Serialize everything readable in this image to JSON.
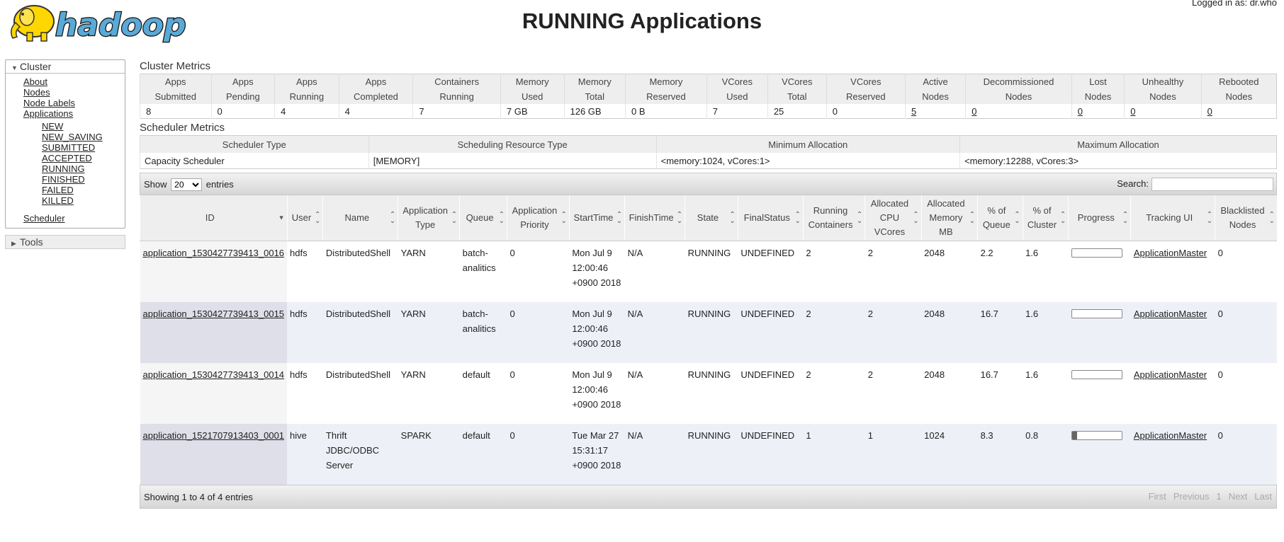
{
  "header": {
    "logo_text": "hadoop",
    "title": "RUNNING Applications",
    "logged_in": "Logged in as: dr.who"
  },
  "sidebar": {
    "cluster_label": "Cluster",
    "links": [
      "About",
      "Nodes",
      "Node Labels",
      "Applications"
    ],
    "app_states": [
      "NEW",
      "NEW_SAVING",
      "SUBMITTED",
      "ACCEPTED",
      "RUNNING",
      "FINISHED",
      "FAILED",
      "KILLED"
    ],
    "scheduler": "Scheduler",
    "tools_label": "Tools"
  },
  "cluster_metrics": {
    "title": "Cluster Metrics",
    "headers": [
      "Apps Submitted",
      "Apps Pending",
      "Apps Running",
      "Apps Completed",
      "Containers Running",
      "Memory Used",
      "Memory Total",
      "Memory Reserved",
      "VCores Used",
      "VCores Total",
      "VCores Reserved",
      "Active Nodes",
      "Decommissioned Nodes",
      "Lost Nodes",
      "Unhealthy Nodes",
      "Rebooted Nodes"
    ],
    "values": [
      "8",
      "0",
      "4",
      "4",
      "7",
      "7 GB",
      "126 GB",
      "0 B",
      "7",
      "25",
      "0",
      "5",
      "0",
      "0",
      "0",
      "0"
    ]
  },
  "scheduler_metrics": {
    "title": "Scheduler Metrics",
    "headers": [
      "Scheduler Type",
      "Scheduling Resource Type",
      "Minimum Allocation",
      "Maximum Allocation"
    ],
    "values": [
      "Capacity Scheduler",
      "[MEMORY]",
      "<memory:1024, vCores:1>",
      "<memory:12288, vCores:3>"
    ]
  },
  "apps_table": {
    "show_label": "Show",
    "entries_label": "entries",
    "page_size": "20",
    "search_label": "Search:",
    "search_value": "",
    "headers": [
      "ID",
      "User",
      "Name",
      "Application Type",
      "Queue",
      "Application Priority",
      "StartTime",
      "FinishTime",
      "State",
      "FinalStatus",
      "Running Containers",
      "Allocated CPU VCores",
      "Allocated Memory MB",
      "% of Queue",
      "% of Cluster",
      "Progress",
      "Tracking UI",
      "Blacklisted Nodes"
    ],
    "rows": [
      {
        "id": "application_1530427739413_0016",
        "user": "hdfs",
        "name": "DistributedShell",
        "type": "YARN",
        "queue": "batch-analitics",
        "priority": "0",
        "start": "Mon Jul 9 12:00:46 +0900 2018",
        "finish": "N/A",
        "state": "RUNNING",
        "final": "UNDEFINED",
        "containers": "2",
        "vcores": "2",
        "memory": "2048",
        "pct_queue": "2.2",
        "pct_cluster": "1.6",
        "progress": 0,
        "tracking": "ApplicationMaster",
        "blacklisted": "0"
      },
      {
        "id": "application_1530427739413_0015",
        "user": "hdfs",
        "name": "DistributedShell",
        "type": "YARN",
        "queue": "batch-analitics",
        "priority": "0",
        "start": "Mon Jul 9 12:00:46 +0900 2018",
        "finish": "N/A",
        "state": "RUNNING",
        "final": "UNDEFINED",
        "containers": "2",
        "vcores": "2",
        "memory": "2048",
        "pct_queue": "16.7",
        "pct_cluster": "1.6",
        "progress": 0,
        "tracking": "ApplicationMaster",
        "blacklisted": "0"
      },
      {
        "id": "application_1530427739413_0014",
        "user": "hdfs",
        "name": "DistributedShell",
        "type": "YARN",
        "queue": "default",
        "priority": "0",
        "start": "Mon Jul 9 12:00:46 +0900 2018",
        "finish": "N/A",
        "state": "RUNNING",
        "final": "UNDEFINED",
        "containers": "2",
        "vcores": "2",
        "memory": "2048",
        "pct_queue": "16.7",
        "pct_cluster": "1.6",
        "progress": 0,
        "tracking": "ApplicationMaster",
        "blacklisted": "0"
      },
      {
        "id": "application_1521707913403_0001",
        "user": "hive",
        "name": "Thrift JDBC/ODBC Server",
        "type": "SPARK",
        "queue": "default",
        "priority": "0",
        "start": "Tue Mar 27 15:31:17 +0900 2018",
        "finish": "N/A",
        "state": "RUNNING",
        "final": "UNDEFINED",
        "containers": "1",
        "vcores": "1",
        "memory": "1024",
        "pct_queue": "8.3",
        "pct_cluster": "0.8",
        "progress": 10,
        "tracking": "ApplicationMaster",
        "blacklisted": "0"
      }
    ],
    "info": "Showing 1 to 4 of 4 entries",
    "pager": [
      "First",
      "Previous",
      "1",
      "Next",
      "Last"
    ]
  }
}
